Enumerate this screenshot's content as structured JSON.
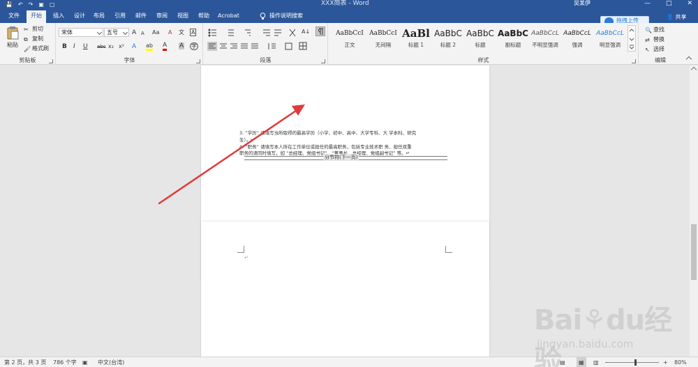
{
  "titlebar": {
    "doc_title": "XXX简表 - Word",
    "user_name": "吴某伊",
    "qat": [
      "💾",
      "↶",
      "↷",
      "▣",
      "▢"
    ],
    "window_controls": [
      "—",
      "□",
      "✕"
    ]
  },
  "menu": {
    "tabs": [
      "文件",
      "开始",
      "插入",
      "设计",
      "布局",
      "引用",
      "邮件",
      "审阅",
      "视图",
      "帮助",
      "Acrobat"
    ],
    "active_tab": "开始",
    "search_label": "操作说明搜索",
    "upload_label": "拖拽上传",
    "share_label": "共享"
  },
  "ribbon": {
    "clipboard": {
      "label": "剪贴板",
      "paste": "粘贴",
      "cut": "剪切",
      "copy": "复制",
      "format_painter": "格式刷"
    },
    "font": {
      "label": "字体",
      "font_name": "宋体",
      "font_size": "五号",
      "grow": "A",
      "shrink": "A",
      "case": "Aa",
      "clear": "A",
      "wen": "文",
      "boxed": "A",
      "bold": "B",
      "italic": "I",
      "underline": "U",
      "strike": "abc",
      "sub": "x₂",
      "sup": "x²",
      "effect": "A",
      "highlight": "ab",
      "color": "A",
      "shade": "A",
      "circle": "字"
    },
    "paragraph": {
      "label": "段落",
      "sort": "A↓"
    },
    "styles": {
      "label": "样式",
      "items": [
        {
          "preview": "AaBbCcI",
          "name": "正文"
        },
        {
          "preview": "AaBbCcI",
          "name": "无间隔"
        },
        {
          "preview": "AaBl",
          "name": "标题 1"
        },
        {
          "preview": "AaBbC",
          "name": "标题 2"
        },
        {
          "preview": "AaBbC",
          "name": "标题"
        },
        {
          "preview": "AaBbC",
          "name": "副标题"
        },
        {
          "preview": "AaBbCcL",
          "name": "不明显强调"
        },
        {
          "preview": "AaBbCcL",
          "name": "强调"
        },
        {
          "preview": "AaBbCcL",
          "name": "明显强调"
        }
      ]
    },
    "editing": {
      "label": "编辑",
      "find": "查找",
      "replace": "替换",
      "select": "选择"
    }
  },
  "document": {
    "page1_lines": [
      "3. “学历” 请填写当所取得的最高学历（小学、初中、高中、大学专科、大 学本科、研究",
      "生）。↵",
      "4. “职务” 请填写本人所在工作单位或担任的最高职务，包括专业技术职  务、担任双重",
      "职务的请同时填写，如 “总经理、党组书记”，“董事长、总经理、党组副书记” 等。↵"
    ],
    "section_break_label": "分节符(下一页)",
    "para_mark": "↵"
  },
  "status": {
    "page": "第 2 页，共 3 页",
    "words": "786 个字",
    "language": "中文(台湾)",
    "zoom": "80%",
    "zoom_minus": "−",
    "zoom_plus": "+"
  },
  "watermark": {
    "text": "Bai⚘du经验",
    "url": "jingyan.baidu.com"
  }
}
